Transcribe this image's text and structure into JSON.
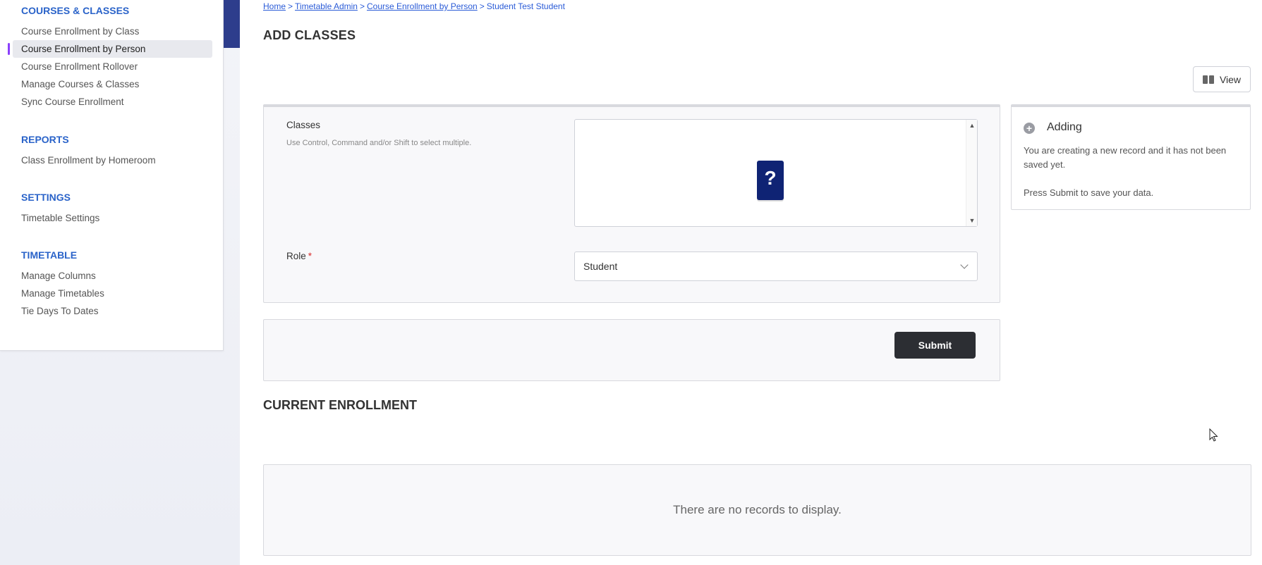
{
  "sidebar": {
    "sections": [
      {
        "heading": "COURSES & CLASSES",
        "items": [
          {
            "label": "Course Enrollment by Class"
          },
          {
            "label": "Course Enrollment by Person"
          },
          {
            "label": "Course Enrollment Rollover"
          },
          {
            "label": "Manage Courses & Classes"
          },
          {
            "label": "Sync Course Enrollment"
          }
        ]
      },
      {
        "heading": "REPORTS",
        "items": [
          {
            "label": "Class Enrollment by Homeroom"
          }
        ]
      },
      {
        "heading": "SETTINGS",
        "items": [
          {
            "label": "Timetable Settings"
          }
        ]
      },
      {
        "heading": "TIMETABLE",
        "items": [
          {
            "label": "Manage Columns"
          },
          {
            "label": "Manage Timetables"
          },
          {
            "label": "Tie Days To Dates"
          }
        ]
      }
    ],
    "active_item": "Course Enrollment by Person"
  },
  "breadcrumb": {
    "items": [
      "Home",
      "Timetable Admin",
      "Course Enrollment by Person"
    ],
    "current": "Student Test Student",
    "separator": ">"
  },
  "page": {
    "title": "ADD CLASSES"
  },
  "toolbar": {
    "view_label": "View"
  },
  "form": {
    "classes_label": "Classes",
    "classes_help": "Use Control, Command and/or Shift to select multiple.",
    "classes_placeholder_icon": "?",
    "role_label": "Role",
    "role_required_marker": "*",
    "role_value": "Student",
    "submit_label": "Submit"
  },
  "info": {
    "title": "Adding",
    "line1": "You are creating a new record and it has not been saved yet.",
    "line2": "Press Submit to save your data."
  },
  "enrollment": {
    "title": "CURRENT ENROLLMENT",
    "empty_message": "There are no records to display."
  },
  "icons": {
    "view": "book-icon",
    "info": "plus-circle-icon",
    "select_chevron": "chevron-down-icon",
    "multiselect_placeholder": "question-icon"
  },
  "colors": {
    "accent_link": "#2a5bd7",
    "heading_blue": "#2a63c9",
    "active_marker": "#8a3ffc",
    "nav_strip": "#2d3d8c",
    "submit_bg": "#2c2e33",
    "placeholder_icon_bg": "#0f2374"
  }
}
